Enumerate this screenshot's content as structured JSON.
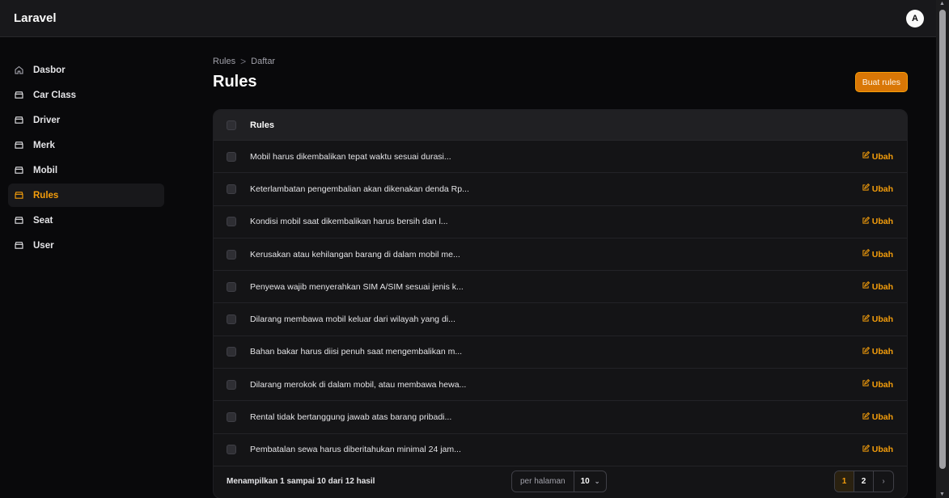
{
  "app": {
    "brand": "Laravel",
    "avatar_initial": "A"
  },
  "sidebar": {
    "items": [
      {
        "label": "Dasbor",
        "icon": "home-icon",
        "active": false
      },
      {
        "label": "Car Class",
        "icon": "folder-icon",
        "active": false
      },
      {
        "label": "Driver",
        "icon": "folder-icon",
        "active": false
      },
      {
        "label": "Merk",
        "icon": "folder-icon",
        "active": false
      },
      {
        "label": "Mobil",
        "icon": "folder-icon",
        "active": false
      },
      {
        "label": "Rules",
        "icon": "folder-icon",
        "active": true
      },
      {
        "label": "Seat",
        "icon": "folder-icon",
        "active": false
      },
      {
        "label": "User",
        "icon": "folder-icon",
        "active": false
      }
    ]
  },
  "breadcrumb": {
    "parent": "Rules",
    "separator": ">",
    "current": "Daftar"
  },
  "page": {
    "title": "Rules",
    "create_button": "Buat rules"
  },
  "table": {
    "header": "Rules",
    "edit_label": "Ubah",
    "rows": [
      "Mobil harus dikembalikan tepat waktu sesuai durasi...",
      "Keterlambatan pengembalian akan dikenakan denda Rp...",
      "Kondisi mobil saat dikembalikan harus bersih dan l...",
      "Kerusakan atau kehilangan barang di dalam mobil me...",
      "Penyewa wajib menyerahkan SIM A/SIM sesuai jenis k...",
      "Dilarang membawa mobil keluar dari wilayah yang di...",
      "Bahan bakar harus diisi penuh saat mengembalikan m...",
      "Dilarang merokok di dalam mobil, atau membawa hewa...",
      "Rental tidak bertanggung jawab atas barang pribadi...",
      "Pembatalan sewa harus diberitahukan minimal 24 jam..."
    ]
  },
  "footer": {
    "summary": "Menampilkan 1 sampai 10 dari 12 hasil",
    "per_page_label": "per halaman",
    "per_page_value": "10",
    "pages": [
      "1",
      "2"
    ],
    "current_page": "1",
    "next_symbol": "›"
  },
  "colors": {
    "accent": "#f59e0b",
    "background": "#09090b",
    "surface": "#141416"
  }
}
